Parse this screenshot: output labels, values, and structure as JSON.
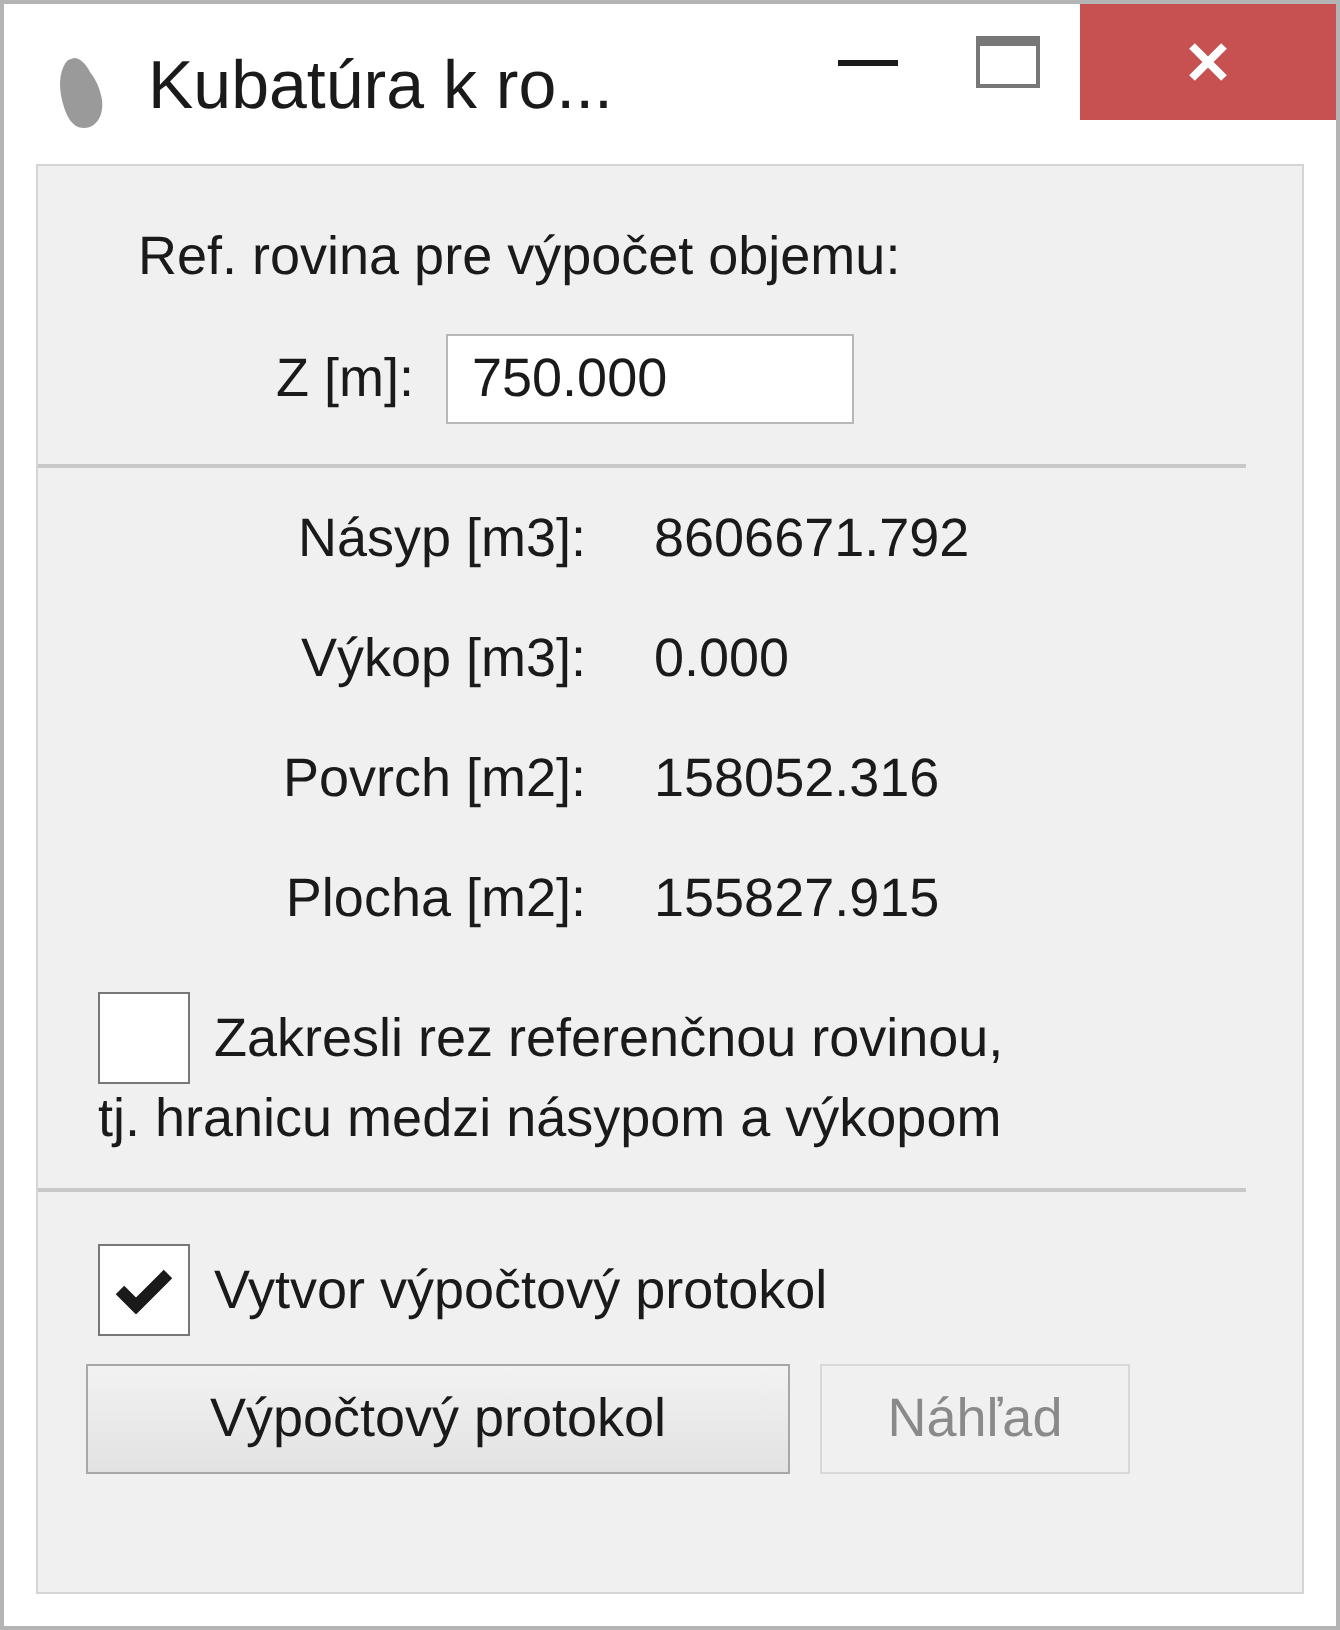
{
  "window": {
    "title": "Kubatúra k ro..."
  },
  "reference": {
    "heading": "Ref. rovina pre výpočet objemu:",
    "label": "Z [m]:",
    "value": "750.000"
  },
  "results": [
    {
      "label": "Násyp [m3]:",
      "value": "8606671.792"
    },
    {
      "label": "Výkop [m3]:",
      "value": "0.000"
    },
    {
      "label": "Povrch [m2]:",
      "value": "158052.316"
    },
    {
      "label": "Plocha [m2]:",
      "value": "155827.915"
    }
  ],
  "draw_section": {
    "label_lines": [
      "Zakresli rez referenčnou rovinou,",
      "tj. hranicu medzi násypom a výkopom"
    ],
    "checked": false
  },
  "protocol": {
    "label": "Vytvor výpočtový protokol",
    "checked": true
  },
  "buttons": [
    {
      "label": "Výpočtový protokol",
      "disabled": false
    },
    {
      "label": "Náhľad",
      "disabled": true
    }
  ]
}
